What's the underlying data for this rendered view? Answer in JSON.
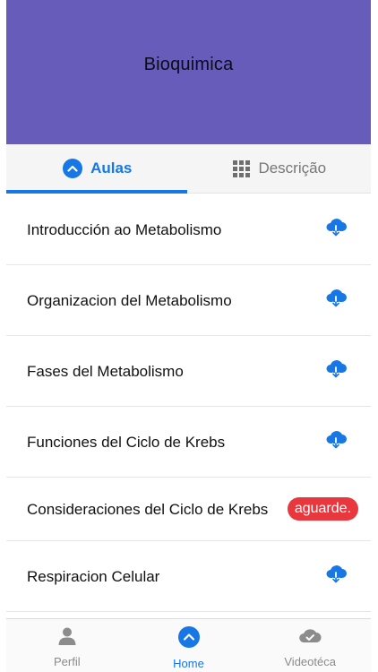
{
  "header": {
    "title": "Bioquimica"
  },
  "tabs": [
    {
      "label": "Aulas",
      "icon": "chevron-up-icon",
      "active": true
    },
    {
      "label": "Descrição",
      "icon": "grid-icon",
      "active": false
    }
  ],
  "lessons": [
    {
      "title": "Introducción ao Metabolismo",
      "status": "download"
    },
    {
      "title": "Organizacion del Metabolismo",
      "status": "download"
    },
    {
      "title": "Fases del Metabolismo",
      "status": "download"
    },
    {
      "title": "Funciones del Ciclo de Krebs",
      "status": "download"
    },
    {
      "title": "Consideraciones del Ciclo de Krebs",
      "status": "waiting",
      "badge": "aguarde."
    },
    {
      "title": "Respiracion Celular",
      "status": "download"
    }
  ],
  "bottom_nav": [
    {
      "label": "Perfil",
      "icon": "person-icon",
      "active": false
    },
    {
      "label": "Home",
      "icon": "home-icon",
      "active": true
    },
    {
      "label": "Videotéca",
      "icon": "cloud-check-icon",
      "active": false
    }
  ],
  "colors": {
    "header_bg": "#675cb9",
    "accent": "#1777e5",
    "badge_bg": "#e8383d"
  }
}
